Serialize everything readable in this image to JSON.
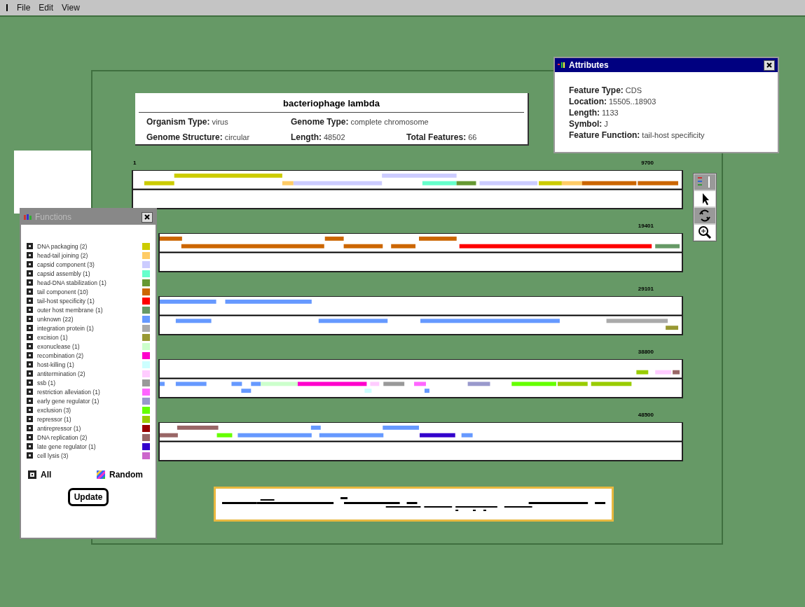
{
  "menu_bar": {
    "items": [
      "File",
      "Edit",
      "View"
    ]
  },
  "genome": {
    "title": "bacteriophage lambda",
    "fields": [
      {
        "label": "Organism Type:",
        "value": "virus"
      },
      {
        "label": "Genome Type:",
        "value": "complete chromosome"
      },
      {
        "label": "Genome Structure:",
        "value": "circular"
      },
      {
        "label": "Length:",
        "value": "48502"
      },
      {
        "label": "Total Features:",
        "value": "66"
      }
    ]
  },
  "attributes": {
    "title": "Attributes",
    "fields": [
      {
        "label": "Feature Type:",
        "value": "CDS"
      },
      {
        "label": "Location:",
        "value": "15505..18903"
      },
      {
        "label": "Length:",
        "value": "1133"
      },
      {
        "label": "Symbol:",
        "value": "J"
      },
      {
        "label": "Feature Function:",
        "value": "tail-host specificity"
      }
    ]
  },
  "tracks": [
    {
      "start": "1",
      "end": "9700"
    },
    {
      "end": "19401"
    },
    {
      "end": "29101"
    },
    {
      "end": "38800"
    },
    {
      "end": "48500"
    }
  ],
  "functions": {
    "title": "Functions",
    "legend": [
      {
        "label": "DNA packaging (2)",
        "color": "#cccc00"
      },
      {
        "label": "head-tail joining (2)",
        "color": "#ffcc66"
      },
      {
        "label": "capsid component (3)",
        "color": "#ccccff"
      },
      {
        "label": "capsid assembly (1)",
        "color": "#66ffcc"
      },
      {
        "label": "head-DNA stabilization (1)",
        "color": "#669933"
      },
      {
        "label": "tail component (10)",
        "color": "#cc6600"
      },
      {
        "label": "tail-host specificity (1)",
        "color": "#ff0000"
      },
      {
        "label": "outer host membrane (1)",
        "color": "#669966"
      },
      {
        "label": "unknown (22)",
        "color": "#6699ff"
      },
      {
        "label": "integration protein (1)",
        "color": "#aaaaaa"
      },
      {
        "label": "excision (1)",
        "color": "#999933"
      },
      {
        "label": "exonuclease (1)",
        "color": "#ccffcc"
      },
      {
        "label": "recombination (2)",
        "color": "#ff00cc"
      },
      {
        "label": "host-killing (1)",
        "color": "#ccffff"
      },
      {
        "label": "antitermination (2)",
        "color": "#ffccff"
      },
      {
        "label": "ssb (1)",
        "color": "#999999"
      },
      {
        "label": "restriction alleviation (1)",
        "color": "#ff66ff"
      },
      {
        "label": "early gene regulator (1)",
        "color": "#9999cc"
      },
      {
        "label": "exclusion (3)",
        "color": "#66ff00"
      },
      {
        "label": "repressor (1)",
        "color": "#99cc00"
      },
      {
        "label": "antirepressor (1)",
        "color": "#990000"
      },
      {
        "label": "DNA replication (2)",
        "color": "#996666"
      },
      {
        "label": "late gene regulator (1)",
        "color": "#3300cc"
      },
      {
        "label": "cell lysis (3)",
        "color": "#cc66cc"
      }
    ],
    "all_label": "All",
    "random_label": "Random",
    "update_button": "Update"
  }
}
